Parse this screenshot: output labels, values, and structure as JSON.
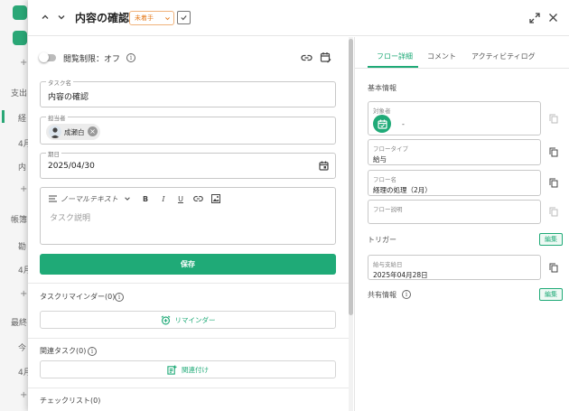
{
  "header": {
    "title": "内容の確認",
    "status": "未着手"
  },
  "left": {
    "visibility_label": "閲覧制限：オフ",
    "task_name": {
      "label": "タスク名",
      "value": "内容の確認"
    },
    "assignee": {
      "label": "担当者",
      "name": "成瀬白"
    },
    "due": {
      "label": "期日",
      "value": "2025/04/30"
    },
    "editor": {
      "format": "ノーマルテキスト",
      "bold": "B",
      "italic": "I",
      "underline": "U",
      "placeholder": "タスク説明"
    },
    "save_label": "保存",
    "reminder": {
      "label": "タスクリマインダー(0)",
      "button": "リマインダー"
    },
    "related": {
      "label": "関連タスク(0)",
      "button": "関連付け"
    },
    "checklist": {
      "label": "チェックリスト(0)"
    }
  },
  "right": {
    "tabs": [
      {
        "label": "フロー詳細"
      },
      {
        "label": "コメント"
      },
      {
        "label": "アクティビティログ"
      }
    ],
    "basic_info": "基本情報",
    "target": {
      "label": "対象者",
      "value": "-"
    },
    "flow_type": {
      "label": "フロータイプ",
      "value": "給与"
    },
    "flow_name": {
      "label": "フロー名",
      "value": "経理の処理（2月）"
    },
    "flow_desc": {
      "label": "フロー説明",
      "value": ""
    },
    "trigger": {
      "heading": "トリガー",
      "edit": "編集",
      "label": "給与支給日",
      "value": "2025年04月28日"
    },
    "shared": {
      "heading": "共有情報",
      "edit": "編集"
    }
  },
  "colors": {
    "accent": "#1faa77",
    "status": "#e67e22"
  },
  "background": {
    "texts": [
      "支出",
      "経",
      "4月",
      "内",
      "帳簿",
      "勘",
      "4月",
      "最終",
      "今",
      "4月"
    ]
  }
}
